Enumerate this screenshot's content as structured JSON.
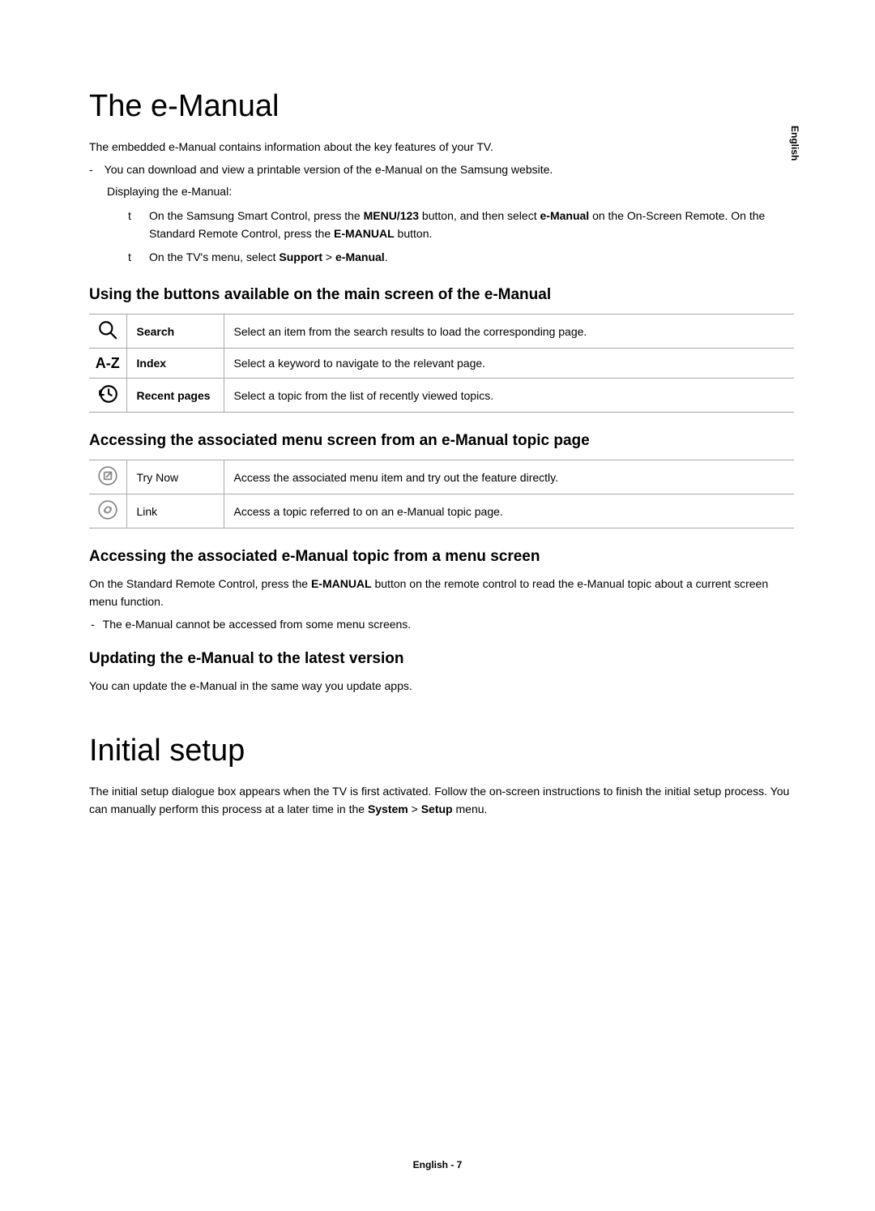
{
  "side_label": "English",
  "h1_1": "The e-Manual",
  "intro1": "The embedded e-Manual contains information about the key features of your TV.",
  "intro2": "You can download and view a printable version of the e-Manual on the Samsung website.",
  "intro3": "Displaying the e-Manual:",
  "bullets1": {
    "a_pre": "On the Samsung Smart Control, press the ",
    "a_b1": "MENU/123",
    "a_mid1": " button, and then select ",
    "a_b2": "e-Manual",
    "a_mid2": " on the On-Screen Remote. On the Standard Remote Control, press the ",
    "a_b3": "E-MANUAL",
    "a_post": " button.",
    "b_pre": "On the TV's menu, select ",
    "b_b1": "Support",
    "b_gt": " > ",
    "b_b2": "e-Manual",
    "b_post": "."
  },
  "h2_1": "Using the buttons available on the main screen of the e-Manual",
  "table1": [
    {
      "label": "Search",
      "desc": "Select an item from the search results to load the corresponding page."
    },
    {
      "label": "Index",
      "desc": "Select a keyword to navigate to the relevant page."
    },
    {
      "label": "Recent pages",
      "desc": "Select a topic from the list of recently viewed topics."
    }
  ],
  "h2_2": "Accessing the associated menu screen from an e-Manual topic page",
  "table2": [
    {
      "label": "Try Now",
      "desc": "Access the associated menu item and try out the feature directly."
    },
    {
      "label": "Link",
      "desc": "Access a topic referred to on an e-Manual topic page."
    }
  ],
  "h2_3": "Accessing the associated e-Manual topic from a menu screen",
  "para3_pre": "On the Standard Remote Control, press the ",
  "para3_b": "E-MANUAL",
  "para3_post": " button on the remote control to read the e-Manual topic about a current screen menu function.",
  "note3": "The e-Manual cannot be accessed from some menu screens.",
  "h2_4": "Updating the e-Manual to the latest version",
  "para4": "You can update the e-Manual in the same way you update apps.",
  "h1_2": "Initial setup",
  "para5_pre": "The initial setup dialogue box appears when the TV is first activated. Follow the on-screen instructions to finish the initial setup process. You can manually perform this process at a later time in the ",
  "para5_b1": "System",
  "para5_gt": " > ",
  "para5_b2": "Setup",
  "para5_post": " menu.",
  "footer": "English - 7",
  "az_text": "A-Z"
}
